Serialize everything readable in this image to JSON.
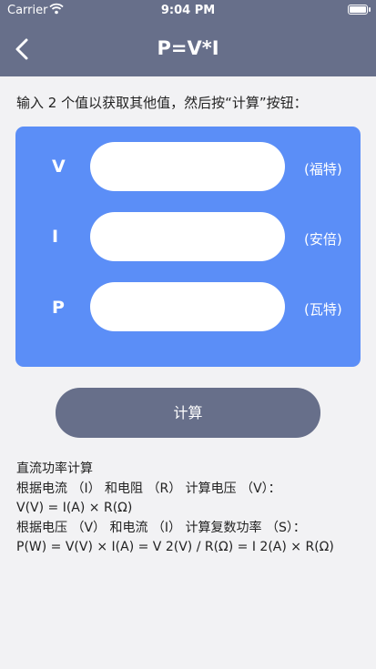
{
  "status_bar": {
    "carrier": "Carrier",
    "time": "9:04 PM"
  },
  "header": {
    "title": "P=V*I"
  },
  "instruction": "输入 2 个值以获取其他值，然后按“计算”按钮：",
  "fields": [
    {
      "label": "V",
      "unit": "(福特)",
      "value": ""
    },
    {
      "label": "I",
      "unit": "(安倍)",
      "value": ""
    },
    {
      "label": "P",
      "unit": "(瓦特)",
      "value": ""
    }
  ],
  "calculate_label": "计算",
  "description": [
    "直流功率计算",
    "根据电流 （I） 和电阻 （R） 计算电压 （V）：",
    "V(V) = I(A) × R(Ω)",
    "根据电压 （V） 和电流 （I） 计算复数功率 （S）：",
    "P(W) = V(V) × I(A) = V 2(V) / R(Ω) = I 2(A) × R(Ω)"
  ],
  "colors": {
    "nav": "#676f8a",
    "card": "#5b8ef7",
    "background": "#f2f2f4"
  }
}
